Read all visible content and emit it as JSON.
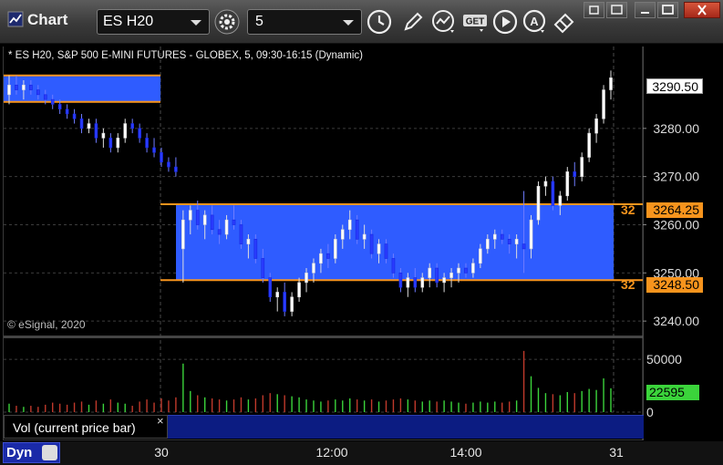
{
  "window": {
    "title": "Chart"
  },
  "toolbar": {
    "symbol": "ES H20",
    "interval": "5",
    "buttons": [
      "settings-icon",
      "clock-icon",
      "pencil-icon",
      "study-icon",
      "get-icon",
      "play-icon",
      "a-icon",
      "eraser-icon"
    ]
  },
  "chart": {
    "header": "* ES H20, S&P 500 E-MINI FUTURES - GLOBEX, 5, 09:30-16:15 (Dynamic)",
    "copyright": "© eSignal, 2020",
    "last_price": "3290.50",
    "level_upper": "3264.25",
    "level_lower": "3248.50",
    "level_upper_prefix": "32",
    "level_lower_prefix": "32",
    "volume_last": "22595",
    "volume_label": "Vol (current price bar)",
    "volume_close": "×",
    "dyn_label": "Dyn",
    "time_labels": [
      "30",
      "12:00",
      "14:00",
      "31"
    ]
  },
  "chart_data": {
    "type": "candlestick",
    "title": "* ES H20, S&P 500 E-MINI FUTURES - GLOBEX, 5, 09:30-16:15 (Dynamic)",
    "price_axis": {
      "range": [
        3237,
        3297
      ],
      "ticks": [
        3240,
        3250,
        3260,
        3270,
        3280
      ]
    },
    "volume_axis": {
      "range": [
        0,
        70000
      ],
      "ticks": [
        0,
        50000
      ]
    },
    "x_ticks": [
      "30",
      "12:00",
      "14:00",
      "31"
    ],
    "colors": {
      "up": "#ffffff",
      "down": "#2a3cff",
      "zone": "#2f5cff",
      "zone_border": "#f7941d",
      "vol_up": "#3bd43b",
      "vol_down": "#c0392b"
    },
    "zones": [
      {
        "high": 3291.0,
        "low": 3285.5
      },
      {
        "high": 3264.25,
        "low": 3248.5
      }
    ],
    "last_price": 3290.5,
    "last_volume": 22595,
    "candles": [
      [
        3287,
        3291,
        3285,
        3289,
        8000
      ],
      [
        3289,
        3291,
        3287,
        3288,
        6000
      ],
      [
        3288,
        3290,
        3286,
        3289,
        5000
      ],
      [
        3289,
        3290,
        3287,
        3288,
        6000
      ],
      [
        3288,
        3289,
        3286,
        3287,
        5000
      ],
      [
        3287,
        3288,
        3285,
        3286,
        7000
      ],
      [
        3286,
        3287,
        3284,
        3285,
        9000
      ],
      [
        3285,
        3286,
        3283,
        3284,
        8000
      ],
      [
        3284,
        3285,
        3282,
        3283,
        7000
      ],
      [
        3283,
        3284,
        3281,
        3282,
        9000
      ],
      [
        3282,
        3283,
        3279,
        3280,
        10000
      ],
      [
        3280,
        3282,
        3279,
        3281,
        7000
      ],
      [
        3281,
        3282,
        3277,
        3278,
        11000
      ],
      [
        3278,
        3280,
        3276,
        3279,
        8000
      ],
      [
        3278,
        3279,
        3275,
        3276,
        12000
      ],
      [
        3276,
        3279,
        3275,
        3278,
        9000
      ],
      [
        3278,
        3282,
        3277,
        3281,
        8000
      ],
      [
        3281,
        3282,
        3279,
        3280,
        6000
      ],
      [
        3280,
        3281,
        3277,
        3278,
        10000
      ],
      [
        3278,
        3279,
        3275,
        3276,
        12000
      ],
      [
        3276,
        3278,
        3274,
        3275,
        9000
      ],
      [
        3275,
        3276,
        3272,
        3273,
        13000
      ],
      [
        3273,
        3274,
        3271,
        3272,
        11000
      ],
      [
        3272,
        3274,
        3270,
        3271,
        14000
      ],
      [
        3255,
        3263,
        3248,
        3261,
        46000
      ],
      [
        3261,
        3264,
        3258,
        3263,
        20000
      ],
      [
        3263,
        3265,
        3259,
        3260,
        16000
      ],
      [
        3260,
        3263,
        3257,
        3262,
        14000
      ],
      [
        3262,
        3264,
        3258,
        3259,
        13000
      ],
      [
        3259,
        3261,
        3256,
        3258,
        12000
      ],
      [
        3258,
        3262,
        3257,
        3261,
        11000
      ],
      [
        3261,
        3264,
        3259,
        3260,
        12000
      ],
      [
        3260,
        3261,
        3255,
        3256,
        14000
      ],
      [
        3256,
        3258,
        3253,
        3257,
        12000
      ],
      [
        3257,
        3258,
        3252,
        3253,
        13000
      ],
      [
        3253,
        3255,
        3248,
        3249,
        16000
      ],
      [
        3249,
        3250,
        3244,
        3245,
        18000
      ],
      [
        3245,
        3247,
        3242,
        3246,
        17000
      ],
      [
        3246,
        3248,
        3241,
        3242,
        16000
      ],
      [
        3242,
        3246,
        3241,
        3245,
        15000
      ],
      [
        3245,
        3249,
        3244,
        3248,
        14000
      ],
      [
        3248,
        3251,
        3246,
        3250,
        12000
      ],
      [
        3250,
        3253,
        3248,
        3252,
        11000
      ],
      [
        3252,
        3255,
        3250,
        3254,
        10000
      ],
      [
        3254,
        3256,
        3251,
        3253,
        11000
      ],
      [
        3253,
        3258,
        3252,
        3257,
        12000
      ],
      [
        3257,
        3260,
        3255,
        3259,
        11000
      ],
      [
        3259,
        3263,
        3257,
        3261,
        13000
      ],
      [
        3261,
        3262,
        3256,
        3257,
        12000
      ],
      [
        3257,
        3260,
        3255,
        3258,
        11000
      ],
      [
        3258,
        3259,
        3253,
        3254,
        12000
      ],
      [
        3254,
        3257,
        3252,
        3256,
        10000
      ],
      [
        3256,
        3257,
        3252,
        3253,
        11000
      ],
      [
        3253,
        3254,
        3249,
        3250,
        12000
      ],
      [
        3250,
        3251,
        3246,
        3247,
        13000
      ],
      [
        3247,
        3250,
        3245,
        3249,
        12000
      ],
      [
        3249,
        3251,
        3246,
        3247,
        11000
      ],
      [
        3247,
        3250,
        3246,
        3249,
        10000
      ],
      [
        3249,
        3252,
        3247,
        3251,
        11000
      ],
      [
        3251,
        3252,
        3247,
        3248,
        10000
      ],
      [
        3248,
        3250,
        3246,
        3249,
        11000
      ],
      [
        3249,
        3251,
        3247,
        3250,
        10000
      ],
      [
        3250,
        3252,
        3248,
        3251,
        9000
      ],
      [
        3251,
        3252,
        3249,
        3250,
        8000
      ],
      [
        3250,
        3253,
        3249,
        3252,
        9000
      ],
      [
        3252,
        3256,
        3251,
        3255,
        10000
      ],
      [
        3255,
        3258,
        3254,
        3257,
        9000
      ],
      [
        3257,
        3259,
        3255,
        3258,
        10000
      ],
      [
        3258,
        3259,
        3256,
        3257,
        9000
      ],
      [
        3257,
        3258,
        3254,
        3256,
        10000
      ],
      [
        3256,
        3258,
        3253,
        3257,
        11000
      ],
      [
        3256,
        3267,
        3250,
        3255,
        58000
      ],
      [
        3255,
        3262,
        3253,
        3261,
        34000
      ],
      [
        3261,
        3269,
        3260,
        3268,
        23000
      ],
      [
        3268,
        3270,
        3266,
        3269,
        18000
      ],
      [
        3269,
        3270,
        3263,
        3264,
        17000
      ],
      [
        3264,
        3267,
        3262,
        3266,
        16000
      ],
      [
        3266,
        3272,
        3265,
        3271,
        19000
      ],
      [
        3271,
        3273,
        3268,
        3270,
        18000
      ],
      [
        3270,
        3275,
        3269,
        3274,
        20000
      ],
      [
        3274,
        3280,
        3273,
        3279,
        22000
      ],
      [
        3279,
        3283,
        3277,
        3282,
        21000
      ],
      [
        3282,
        3289,
        3281,
        3288,
        32000
      ],
      [
        3288,
        3292,
        3286,
        3290.5,
        22595
      ]
    ]
  }
}
